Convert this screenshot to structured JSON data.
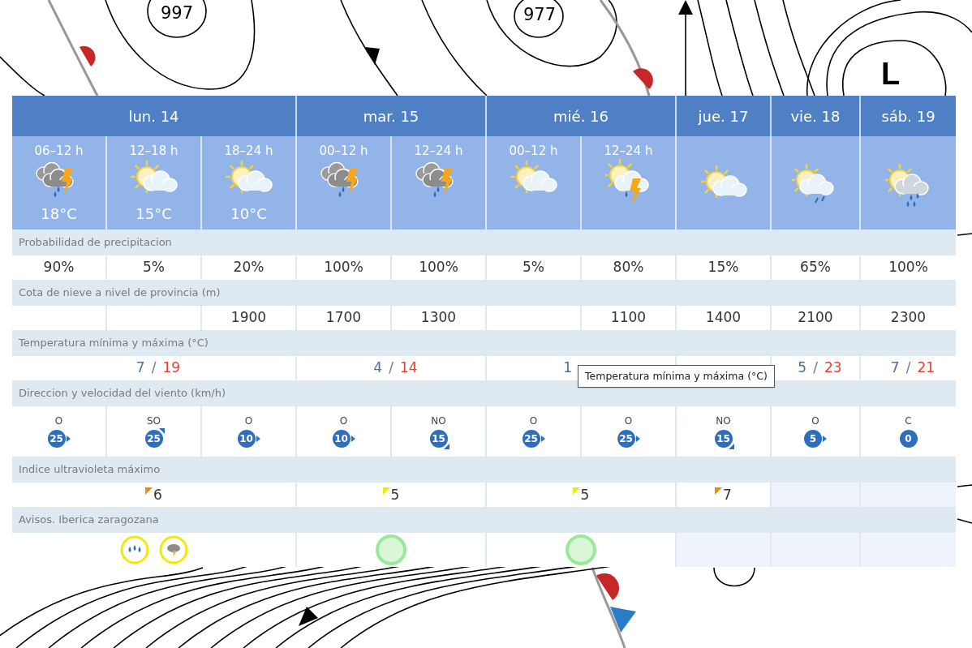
{
  "map": {
    "labels": [
      {
        "kind": "pressure",
        "text": "997"
      },
      {
        "kind": "pressure",
        "text": "977"
      },
      {
        "kind": "low",
        "text": "L"
      }
    ]
  },
  "days": [
    {
      "label": "lun. 14",
      "temp": {
        "min": "7",
        "separator": "/",
        "max": "19"
      },
      "uv": {
        "text": "6",
        "color": "#f08c00"
      },
      "warnings": [
        {
          "kind": "rain",
          "color": "#f2ea00"
        },
        {
          "kind": "storm",
          "color": "#f2ea00"
        }
      ],
      "periods": [
        {
          "time": "06–12 h",
          "kind": "storm",
          "temp": "18°C",
          "precip": "90%",
          "wind": {
            "dir": "O",
            "speed": "25",
            "kind": "east"
          }
        },
        {
          "time": "12–18 h",
          "kind": "sun-cloud",
          "temp": "15°C",
          "precip": "5%",
          "wind": {
            "dir": "SO",
            "speed": "25",
            "kind": "northeast"
          }
        },
        {
          "time": "18–24 h",
          "kind": "sun-cloud",
          "temp": "10°C",
          "precip": "20%",
          "snow": "1900",
          "wind": {
            "dir": "O",
            "speed": "10",
            "kind": "east"
          }
        }
      ]
    },
    {
      "label": "mar. 15",
      "temp": {
        "min": "4",
        "separator": "/",
        "max": "14"
      },
      "uv": {
        "text": "5",
        "color": "#f2ea00"
      },
      "warnings": [
        {
          "kind": "none",
          "color": "#9be89b"
        }
      ],
      "periods": [
        {
          "time": "00–12 h",
          "kind": "storm",
          "precip": "100%",
          "snow": "1700",
          "wind": {
            "dir": "O",
            "speed": "10",
            "kind": "east"
          }
        },
        {
          "time": "12–24 h",
          "kind": "storm",
          "precip": "100%",
          "snow": "1300",
          "wind": {
            "dir": "NO",
            "speed": "15",
            "kind": "southeast"
          }
        }
      ]
    },
    {
      "label": "mié. 16",
      "temp": {
        "min": "1"
      },
      "uv": {
        "text": "5",
        "color": "#f2ea00"
      },
      "warnings": [
        {
          "kind": "none",
          "color": "#9be89b"
        }
      ],
      "periods": [
        {
          "time": "00–12 h",
          "kind": "sun-cloud",
          "precip": "5%",
          "wind": {
            "dir": "O",
            "speed": "25",
            "kind": "east"
          }
        },
        {
          "time": "12–24 h",
          "kind": "sun-cloud-storm",
          "precip": "80%",
          "snow": "1100",
          "wind": {
            "dir": "O",
            "speed": "25",
            "kind": "east"
          }
        }
      ]
    },
    {
      "label": "jue. 17",
      "uv": {
        "text": "7",
        "color": "#f08c00"
      },
      "periods": [
        {
          "kind": "sun-cloud",
          "precip": "15%",
          "snow": "1400",
          "wind": {
            "dir": "NO",
            "speed": "15",
            "kind": "southeast"
          }
        }
      ]
    },
    {
      "label": "vie. 18",
      "temp": {
        "min": "5",
        "separator": "/",
        "max": "23"
      },
      "periods": [
        {
          "kind": "sun-cloud-rain",
          "precip": "65%",
          "snow": "2100",
          "wind": {
            "dir": "O",
            "speed": "5",
            "kind": "east"
          }
        }
      ]
    },
    {
      "label": "sáb. 19",
      "temp": {
        "min": "7",
        "separator": "/",
        "max": "21"
      },
      "periods": [
        {
          "kind": "sun-cloud-heavy-rain",
          "precip": "100%",
          "snow": "2300",
          "wind": {
            "dir": "C",
            "speed": "0",
            "kind": "none"
          }
        }
      ]
    }
  ],
  "rows": [
    {
      "kind": "precip",
      "label": "Probabilidad de precipitacion"
    },
    {
      "kind": "snow",
      "label": "Cota de nieve a nivel de provincia (m)"
    },
    {
      "kind": "temp",
      "label": "Temperatura mínima y máxima (°C)"
    },
    {
      "kind": "wind",
      "label": "Direccion y velocidad del viento (km/h)"
    },
    {
      "kind": "uv",
      "label": "Indice ultravioleta máximo"
    },
    {
      "kind": "warnings",
      "label": "Avisos. Iberica zaragozana"
    }
  ],
  "tooltip": {
    "text": "Temperatura mínima y máxima (°C)"
  }
}
